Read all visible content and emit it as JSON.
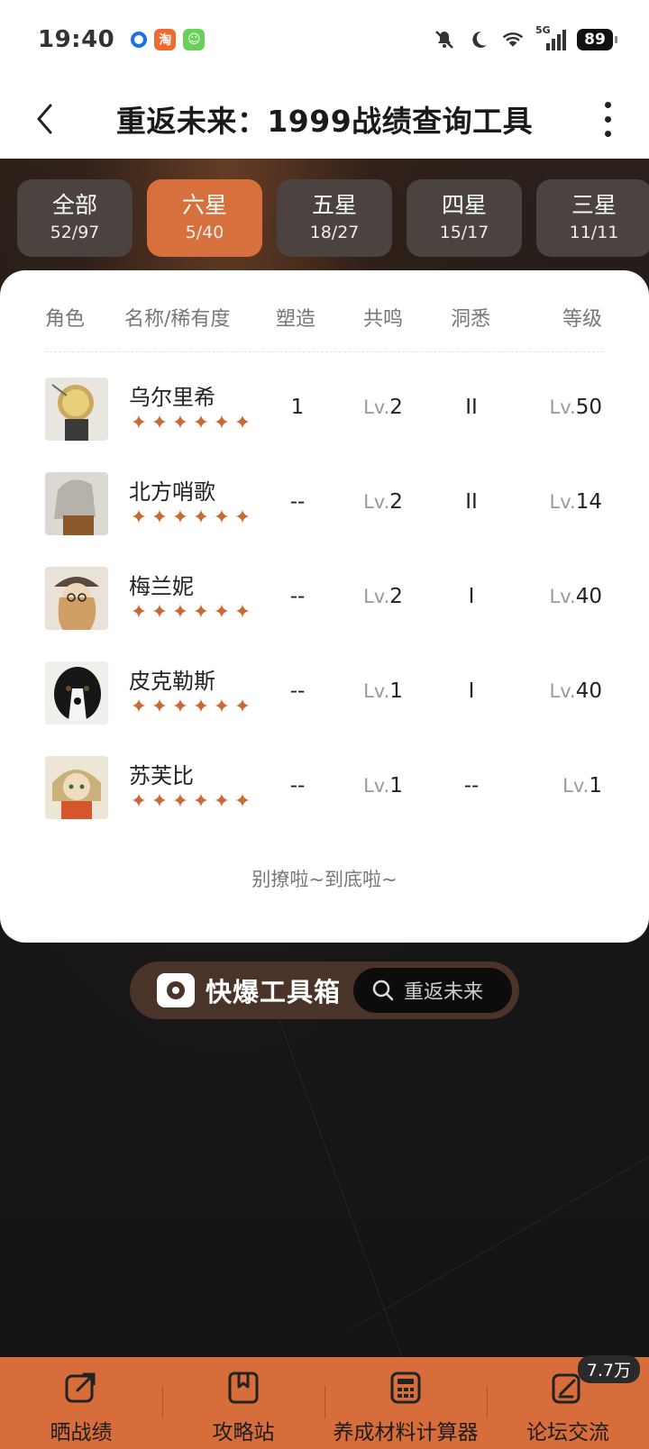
{
  "status_bar": {
    "time": "19:40",
    "notification_icons": [
      "baidu-icon",
      "taobao-icon",
      "app-icon"
    ],
    "network_label": "5G",
    "battery": "89"
  },
  "header": {
    "title": "重返未来：1999战绩查询工具"
  },
  "tabs": [
    {
      "name": "全部",
      "count": "52/97",
      "active": false
    },
    {
      "name": "六星",
      "count": "5/40",
      "active": true
    },
    {
      "name": "五星",
      "count": "18/27",
      "active": false
    },
    {
      "name": "四星",
      "count": "15/17",
      "active": false
    },
    {
      "name": "三星",
      "count": "11/11",
      "active": false
    }
  ],
  "table": {
    "headers": {
      "role": "角色",
      "name_rarity": "名称/稀有度",
      "shape": "塑造",
      "resonance": "共鸣",
      "insight": "洞悉",
      "level": "等级"
    },
    "rows": [
      {
        "name": "乌尔里希",
        "stars": 6,
        "shape": "1",
        "resonance_prefix": "Lv.",
        "resonance": "2",
        "insight": "II",
        "level_prefix": "Lv.",
        "level": "50"
      },
      {
        "name": "北方哨歌",
        "stars": 6,
        "shape": "--",
        "resonance_prefix": "Lv.",
        "resonance": "2",
        "insight": "II",
        "level_prefix": "Lv.",
        "level": "14"
      },
      {
        "name": "梅兰妮",
        "stars": 6,
        "shape": "--",
        "resonance_prefix": "Lv.",
        "resonance": "2",
        "insight": "I",
        "level_prefix": "Lv.",
        "level": "40"
      },
      {
        "name": "皮克勒斯",
        "stars": 6,
        "shape": "--",
        "resonance_prefix": "Lv.",
        "resonance": "1",
        "insight": "I",
        "level_prefix": "Lv.",
        "level": "40"
      },
      {
        "name": "苏芙比",
        "stars": 6,
        "shape": "--",
        "resonance_prefix": "Lv.",
        "resonance": "1",
        "insight": "--",
        "level_prefix": "Lv.",
        "level": "1"
      }
    ],
    "end_text": "别撩啦~到底啦~"
  },
  "toolbox": {
    "brand": "快爆工具箱",
    "search_text": "重返未来"
  },
  "bottom_nav": [
    {
      "label": "晒战绩",
      "icon": "share-icon"
    },
    {
      "label": "攻略站",
      "icon": "book-icon"
    },
    {
      "label": "养成材料计算器",
      "icon": "calculator-icon"
    },
    {
      "label": "论坛交流",
      "icon": "forum-icon",
      "badge": "7.7万"
    }
  ],
  "colors": {
    "accent": "#d8703e",
    "tab_inactive": "#4a4340",
    "star": "#c86a35",
    "nav_bg": "#d66d3b"
  }
}
